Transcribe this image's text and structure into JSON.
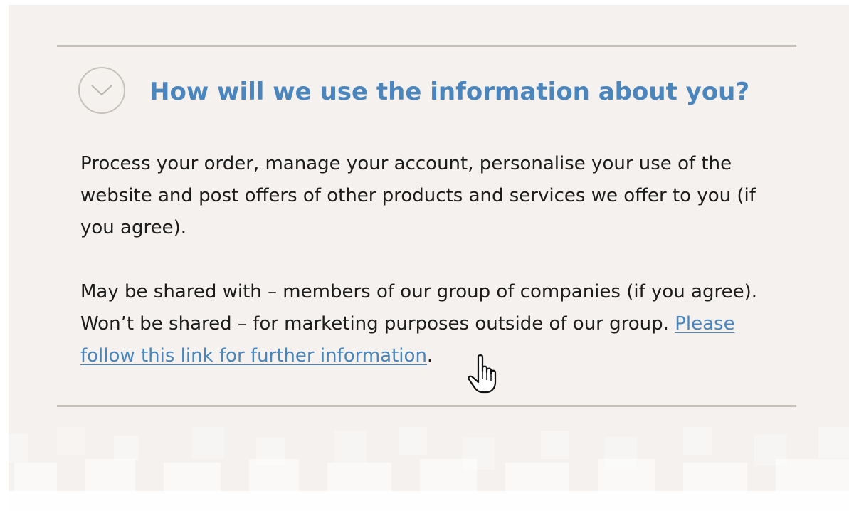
{
  "section": {
    "heading": "How will we use the information about you?",
    "toggle_icon": "chevron-down-icon",
    "paragraph_1": "Process your order, manage your account, personalise your use of the website and post offers of other products and services we offer to you (if you agree).",
    "paragraph_2_text": "May be shared with – members of our group of companies (if you agree). Won’t be shared – for marketing purposes outside of our group. ",
    "link_text": "Please follow this link for further information",
    "link_trailing": "."
  },
  "colors": {
    "heading": "#4a86bd",
    "link": "#4a86bd",
    "panel_background": "#f4f1ee",
    "divider": "#c4c0b9",
    "body_text": "#1c1c1c"
  },
  "cursor_icon": "hand-pointer-icon"
}
